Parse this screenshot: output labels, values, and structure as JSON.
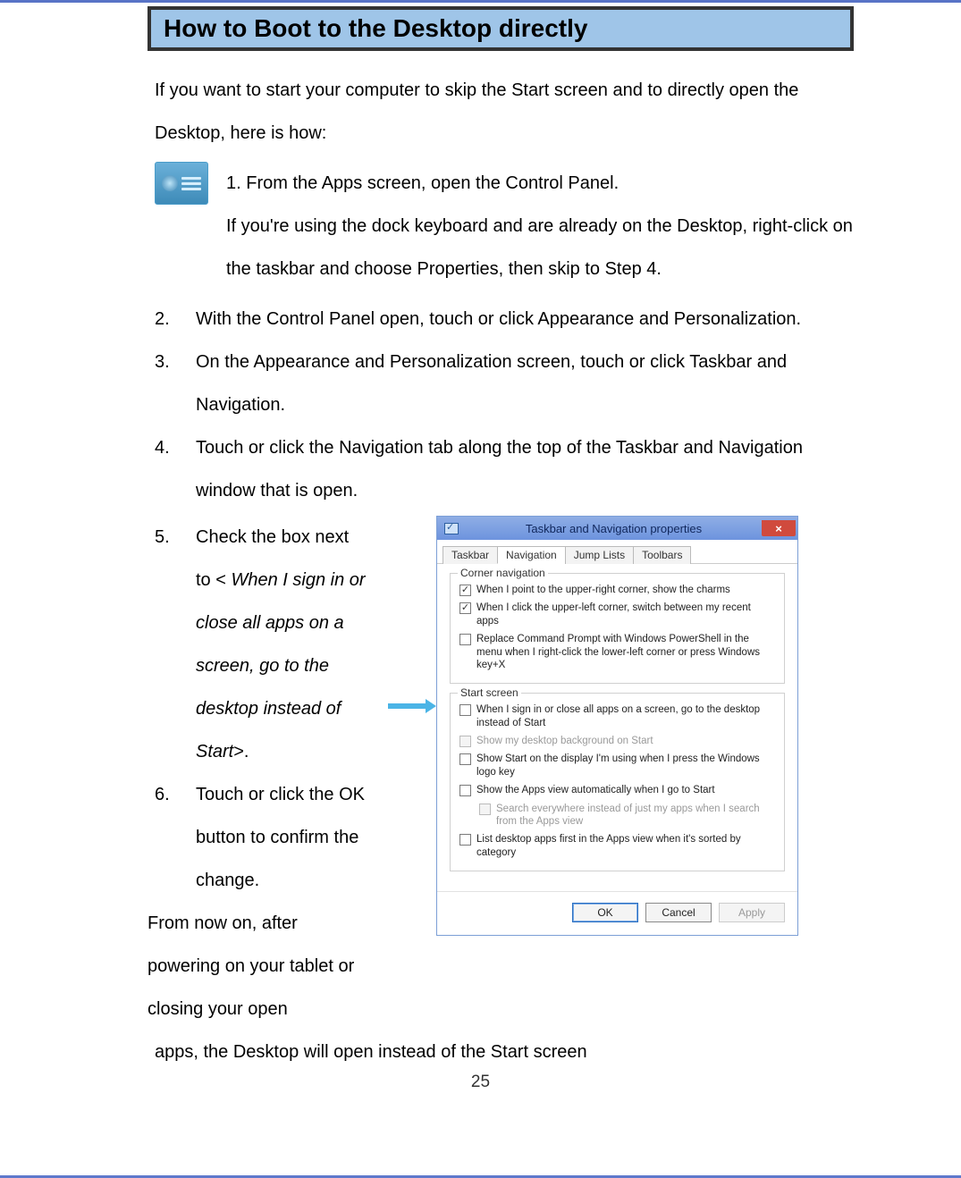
{
  "title": "How to Boot to the Desktop directly",
  "intro": "If you want to start your computer to skip the Start screen and to directly open the Desktop, here is how:",
  "step1": {
    "line1": "1. From the Apps screen, open the Control Panel.",
    "line2": "If you're using the dock keyboard and are already on the Desktop, right-click on the taskbar and choose Properties, then skip to Step 4."
  },
  "steps": [
    {
      "num": "2.",
      "text": "With the Control Panel open, touch or click Appearance and Personalization."
    },
    {
      "num": "3.",
      "text": "On the Appearance and Personalization screen, touch or click Taskbar and Navigation."
    },
    {
      "num": "4.",
      "text": "Touch or click the Navigation tab along the top of the Taskbar and Navigation window that is open."
    }
  ],
  "step5": {
    "num": "5.",
    "prefix": "Check the box next to < ",
    "italic": "When I sign in or close all apps on a screen, go to the desktop instead of Start",
    "suffix": ">."
  },
  "step6": {
    "num": "6.",
    "text": "Touch or click the OK button to confirm the change."
  },
  "conclusion": "From now on, after powering on your tablet or closing your open apps, the Desktop will open instead of the Start screen",
  "dialog": {
    "title": "Taskbar and Navigation properties",
    "tabs": [
      "Taskbar",
      "Navigation",
      "Jump Lists",
      "Toolbars"
    ],
    "active_tab": 1,
    "group1": {
      "label": "Corner navigation",
      "opts": [
        {
          "checked": true,
          "disabled": false,
          "text": "When I point to the upper-right corner, show the charms"
        },
        {
          "checked": true,
          "disabled": false,
          "text": "When I click the upper-left corner, switch between my recent apps"
        },
        {
          "checked": false,
          "disabled": false,
          "text": "Replace Command Prompt with Windows PowerShell in the menu when I right-click the lower-left corner or press Windows key+X"
        }
      ]
    },
    "group2": {
      "label": "Start screen",
      "opts": [
        {
          "checked": false,
          "disabled": false,
          "sub": false,
          "text": "When I sign in or close all apps on a screen, go to the desktop instead of Start"
        },
        {
          "checked": false,
          "disabled": true,
          "sub": false,
          "text": "Show my desktop background on Start"
        },
        {
          "checked": false,
          "disabled": false,
          "sub": false,
          "text": "Show Start on the display I'm using when I press the Windows logo key"
        },
        {
          "checked": false,
          "disabled": false,
          "sub": false,
          "text": "Show the Apps view automatically when I go to Start"
        },
        {
          "checked": false,
          "disabled": true,
          "sub": true,
          "text": "Search everywhere instead of just my apps when I search from the Apps view"
        },
        {
          "checked": false,
          "disabled": false,
          "sub": false,
          "text": "List desktop apps first in the Apps view when it's sorted by category"
        }
      ]
    },
    "buttons": {
      "ok": "OK",
      "cancel": "Cancel",
      "apply": "Apply"
    }
  },
  "page_number": "25"
}
